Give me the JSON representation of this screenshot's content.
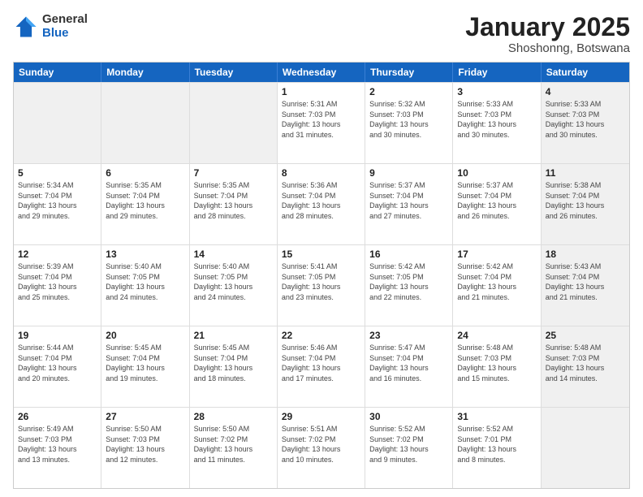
{
  "logo": {
    "general": "General",
    "blue": "Blue"
  },
  "title": "January 2025",
  "subtitle": "Shoshonng, Botswana",
  "header_days": [
    "Sunday",
    "Monday",
    "Tuesday",
    "Wednesday",
    "Thursday",
    "Friday",
    "Saturday"
  ],
  "weeks": [
    [
      {
        "day": "",
        "text": "",
        "shaded": true
      },
      {
        "day": "",
        "text": "",
        "shaded": true
      },
      {
        "day": "",
        "text": "",
        "shaded": true
      },
      {
        "day": "1",
        "text": "Sunrise: 5:31 AM\nSunset: 7:03 PM\nDaylight: 13 hours\nand 31 minutes.",
        "shaded": false
      },
      {
        "day": "2",
        "text": "Sunrise: 5:32 AM\nSunset: 7:03 PM\nDaylight: 13 hours\nand 30 minutes.",
        "shaded": false
      },
      {
        "day": "3",
        "text": "Sunrise: 5:33 AM\nSunset: 7:03 PM\nDaylight: 13 hours\nand 30 minutes.",
        "shaded": false
      },
      {
        "day": "4",
        "text": "Sunrise: 5:33 AM\nSunset: 7:03 PM\nDaylight: 13 hours\nand 30 minutes.",
        "shaded": true
      }
    ],
    [
      {
        "day": "5",
        "text": "Sunrise: 5:34 AM\nSunset: 7:04 PM\nDaylight: 13 hours\nand 29 minutes.",
        "shaded": false
      },
      {
        "day": "6",
        "text": "Sunrise: 5:35 AM\nSunset: 7:04 PM\nDaylight: 13 hours\nand 29 minutes.",
        "shaded": false
      },
      {
        "day": "7",
        "text": "Sunrise: 5:35 AM\nSunset: 7:04 PM\nDaylight: 13 hours\nand 28 minutes.",
        "shaded": false
      },
      {
        "day": "8",
        "text": "Sunrise: 5:36 AM\nSunset: 7:04 PM\nDaylight: 13 hours\nand 28 minutes.",
        "shaded": false
      },
      {
        "day": "9",
        "text": "Sunrise: 5:37 AM\nSunset: 7:04 PM\nDaylight: 13 hours\nand 27 minutes.",
        "shaded": false
      },
      {
        "day": "10",
        "text": "Sunrise: 5:37 AM\nSunset: 7:04 PM\nDaylight: 13 hours\nand 26 minutes.",
        "shaded": false
      },
      {
        "day": "11",
        "text": "Sunrise: 5:38 AM\nSunset: 7:04 PM\nDaylight: 13 hours\nand 26 minutes.",
        "shaded": true
      }
    ],
    [
      {
        "day": "12",
        "text": "Sunrise: 5:39 AM\nSunset: 7:04 PM\nDaylight: 13 hours\nand 25 minutes.",
        "shaded": false
      },
      {
        "day": "13",
        "text": "Sunrise: 5:40 AM\nSunset: 7:05 PM\nDaylight: 13 hours\nand 24 minutes.",
        "shaded": false
      },
      {
        "day": "14",
        "text": "Sunrise: 5:40 AM\nSunset: 7:05 PM\nDaylight: 13 hours\nand 24 minutes.",
        "shaded": false
      },
      {
        "day": "15",
        "text": "Sunrise: 5:41 AM\nSunset: 7:05 PM\nDaylight: 13 hours\nand 23 minutes.",
        "shaded": false
      },
      {
        "day": "16",
        "text": "Sunrise: 5:42 AM\nSunset: 7:05 PM\nDaylight: 13 hours\nand 22 minutes.",
        "shaded": false
      },
      {
        "day": "17",
        "text": "Sunrise: 5:42 AM\nSunset: 7:04 PM\nDaylight: 13 hours\nand 21 minutes.",
        "shaded": false
      },
      {
        "day": "18",
        "text": "Sunrise: 5:43 AM\nSunset: 7:04 PM\nDaylight: 13 hours\nand 21 minutes.",
        "shaded": true
      }
    ],
    [
      {
        "day": "19",
        "text": "Sunrise: 5:44 AM\nSunset: 7:04 PM\nDaylight: 13 hours\nand 20 minutes.",
        "shaded": false
      },
      {
        "day": "20",
        "text": "Sunrise: 5:45 AM\nSunset: 7:04 PM\nDaylight: 13 hours\nand 19 minutes.",
        "shaded": false
      },
      {
        "day": "21",
        "text": "Sunrise: 5:45 AM\nSunset: 7:04 PM\nDaylight: 13 hours\nand 18 minutes.",
        "shaded": false
      },
      {
        "day": "22",
        "text": "Sunrise: 5:46 AM\nSunset: 7:04 PM\nDaylight: 13 hours\nand 17 minutes.",
        "shaded": false
      },
      {
        "day": "23",
        "text": "Sunrise: 5:47 AM\nSunset: 7:04 PM\nDaylight: 13 hours\nand 16 minutes.",
        "shaded": false
      },
      {
        "day": "24",
        "text": "Sunrise: 5:48 AM\nSunset: 7:03 PM\nDaylight: 13 hours\nand 15 minutes.",
        "shaded": false
      },
      {
        "day": "25",
        "text": "Sunrise: 5:48 AM\nSunset: 7:03 PM\nDaylight: 13 hours\nand 14 minutes.",
        "shaded": true
      }
    ],
    [
      {
        "day": "26",
        "text": "Sunrise: 5:49 AM\nSunset: 7:03 PM\nDaylight: 13 hours\nand 13 minutes.",
        "shaded": false
      },
      {
        "day": "27",
        "text": "Sunrise: 5:50 AM\nSunset: 7:03 PM\nDaylight: 13 hours\nand 12 minutes.",
        "shaded": false
      },
      {
        "day": "28",
        "text": "Sunrise: 5:50 AM\nSunset: 7:02 PM\nDaylight: 13 hours\nand 11 minutes.",
        "shaded": false
      },
      {
        "day": "29",
        "text": "Sunrise: 5:51 AM\nSunset: 7:02 PM\nDaylight: 13 hours\nand 10 minutes.",
        "shaded": false
      },
      {
        "day": "30",
        "text": "Sunrise: 5:52 AM\nSunset: 7:02 PM\nDaylight: 13 hours\nand 9 minutes.",
        "shaded": false
      },
      {
        "day": "31",
        "text": "Sunrise: 5:52 AM\nSunset: 7:01 PM\nDaylight: 13 hours\nand 8 minutes.",
        "shaded": false
      },
      {
        "day": "",
        "text": "",
        "shaded": true
      }
    ]
  ]
}
